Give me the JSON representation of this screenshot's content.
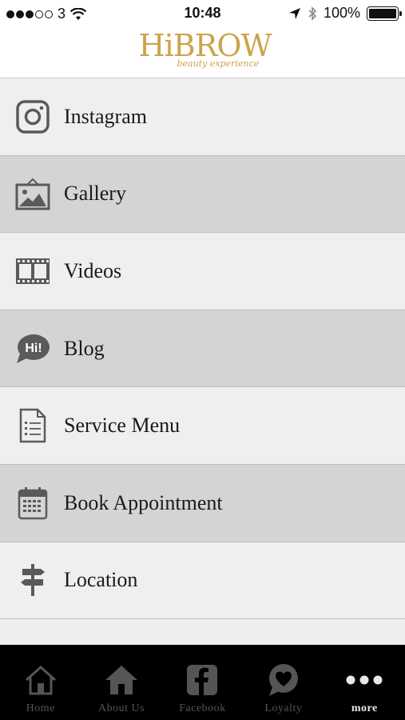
{
  "status_bar": {
    "carrier": "3",
    "time": "10:48",
    "battery": "100%",
    "battery_level": 1.0,
    "signal_bars_filled": 3,
    "signal_bars_total": 5
  },
  "header": {
    "logo_text": "HiBROW",
    "logo_tagline": "beauty experience",
    "logo_color": "#cba44a"
  },
  "menu": {
    "items": [
      {
        "label": "Instagram",
        "icon": "instagram-icon"
      },
      {
        "label": "Gallery",
        "icon": "gallery-icon"
      },
      {
        "label": "Videos",
        "icon": "film-strip-icon"
      },
      {
        "label": "Blog",
        "icon": "speech-bubble-hi-icon",
        "icon_text": "Hi!"
      },
      {
        "label": "Service Menu",
        "icon": "document-list-icon"
      },
      {
        "label": "Book Appointment",
        "icon": "calendar-icon"
      },
      {
        "label": "Location",
        "icon": "signpost-icon"
      }
    ]
  },
  "tabbar": {
    "tabs": [
      {
        "label": "Home",
        "icon": "home-outline-icon"
      },
      {
        "label": "About Us",
        "icon": "home-icon"
      },
      {
        "label": "Facebook",
        "icon": "facebook-icon"
      },
      {
        "label": "Loyalty",
        "icon": "heart-bubble-icon"
      },
      {
        "label": "more",
        "icon": "more-dots-icon",
        "active": true
      }
    ]
  }
}
